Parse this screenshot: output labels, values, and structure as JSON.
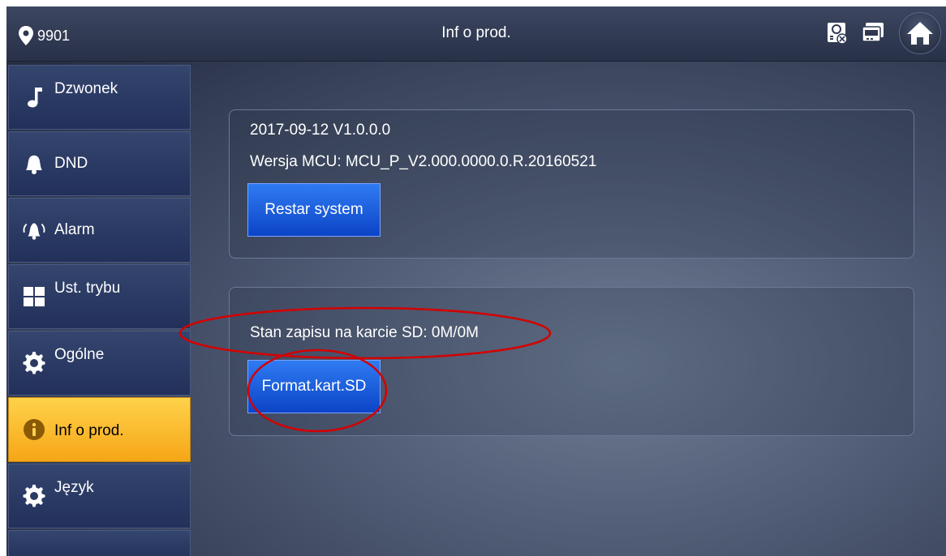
{
  "header": {
    "location": "9901",
    "title": "Inf o prod.",
    "status_icons": [
      "sd-card-status-icon",
      "network-status-icon"
    ],
    "home_icon": "home-icon"
  },
  "sidebar": {
    "items": [
      {
        "label": "Dzwonek",
        "icon": "music-note-icon",
        "active": false
      },
      {
        "label": "DND",
        "icon": "bell-icon",
        "active": false
      },
      {
        "label": "Alarm",
        "icon": "alarm-icon",
        "active": false
      },
      {
        "label": "Ust. trybu",
        "icon": "grid-icon",
        "active": false
      },
      {
        "label": "Ogólne",
        "icon": "gear-icon",
        "active": false
      },
      {
        "label": "Inf o prod.",
        "icon": "info-icon",
        "active": true
      },
      {
        "label": "Język",
        "icon": "gear-icon",
        "active": false
      }
    ]
  },
  "main": {
    "version_panel": {
      "date_version": "2017-09-12 V1.0.0.0",
      "mcu_version": "Wersja MCU: MCU_P_V2.000.0000.0.R.20160521",
      "restart_label": "Restar system"
    },
    "sd_panel": {
      "sd_status": "Stan zapisu na karcie SD: 0M/0M",
      "format_label": "Format.kart.SD"
    }
  },
  "colors": {
    "active_tab": "#f6a616",
    "button_blue": "#1a5ae0",
    "annotation_red": "#d40000"
  }
}
